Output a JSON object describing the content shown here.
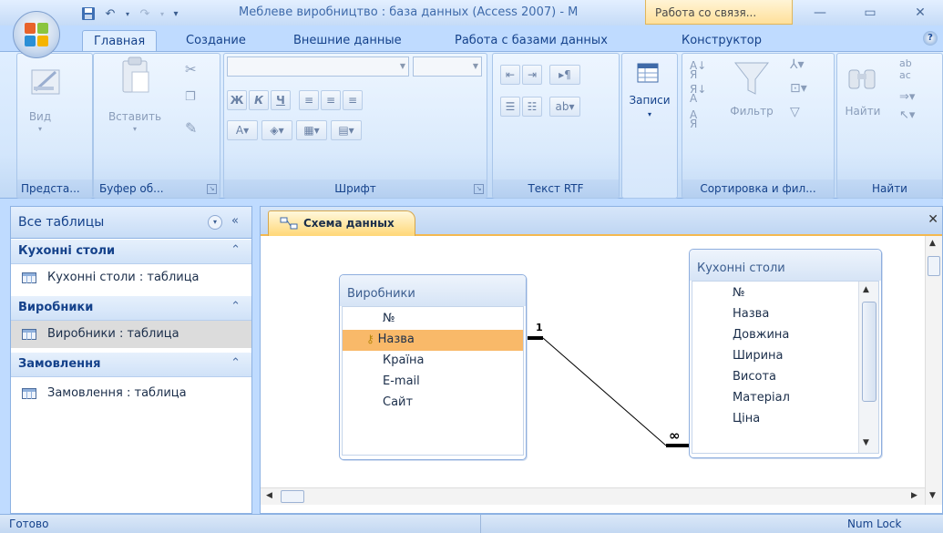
{
  "window": {
    "title": "Меблеве виробництво : база данных (Access 2007) - M",
    "context_tab_title": "Работа со связя..."
  },
  "tabs": [
    "Главная",
    "Создание",
    "Внешние данные",
    "Работа с базами данных",
    "Конструктор"
  ],
  "ribbon": {
    "groups": {
      "views": "Предста...",
      "clipboard": "Буфер об...",
      "font": "Шрифт",
      "rtf": "Текст RTF",
      "records": "Записи",
      "sort": "Сортировка и фил...",
      "find": "Найти"
    },
    "view_label": "Вид",
    "paste_label": "Вставить",
    "records_label": "Записи",
    "filter_label": "Фильтр",
    "find_label": "Найти",
    "bold": "Ж",
    "italic": "К",
    "underline": "Ч"
  },
  "nav": {
    "header": "Все таблицы",
    "groups": [
      {
        "title": "Кухонні столи",
        "item": "Кухонні столи : таблица"
      },
      {
        "title": "Виробники",
        "item": "Виробники : таблица"
      },
      {
        "title": "Замовлення",
        "item": "Замовлення : таблица"
      }
    ]
  },
  "document": {
    "tab_label": "Схема данных"
  },
  "schema": {
    "tables": [
      {
        "name": "Виробники",
        "fields": [
          "№",
          "Назва",
          "Країна",
          "E-mail",
          "Сайт"
        ],
        "primary_key": "Назва"
      },
      {
        "name": "Кухонні столи",
        "fields": [
          "№",
          "Назва",
          "Довжина",
          "Ширина",
          "Висота",
          "Матеріал",
          "Ціна"
        ]
      }
    ],
    "relation": {
      "one_label": "1",
      "many_label": "∞"
    }
  },
  "status": {
    "left": "Готово",
    "right": "Num Lock"
  },
  "colors": {
    "accent": "#f9b969",
    "ribbon": "#dfeeff",
    "text": "#15428b"
  }
}
